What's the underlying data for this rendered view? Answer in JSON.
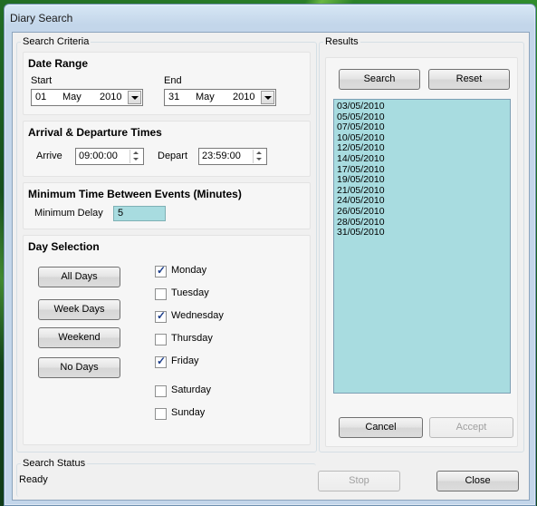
{
  "window": {
    "title": "Diary Search"
  },
  "search_criteria": {
    "legend": "Search Criteria",
    "date_range": {
      "heading": "Date Range",
      "start_label": "Start",
      "end_label": "End",
      "start": {
        "day": "01",
        "month": "May",
        "year": "2010"
      },
      "end": {
        "day": "31",
        "month": "May",
        "year": "2010"
      }
    },
    "times": {
      "heading": "Arrival & Departure Times",
      "arrive_label": "Arrive",
      "arrive_value": "09:00:00",
      "depart_label": "Depart",
      "depart_value": "23:59:00"
    },
    "min_time": {
      "heading": "Minimum Time Between Events (Minutes)",
      "label": "Minimum Delay",
      "value": "5"
    },
    "day_selection": {
      "heading": "Day Selection",
      "buttons": [
        "All Days",
        "Week Days",
        "Weekend",
        "No Days"
      ],
      "days": [
        {
          "label": "Monday",
          "checked": true
        },
        {
          "label": "Tuesday",
          "checked": false
        },
        {
          "label": "Wednesday",
          "checked": true
        },
        {
          "label": "Thursday",
          "checked": false
        },
        {
          "label": "Friday",
          "checked": true
        },
        {
          "label": "Saturday",
          "checked": false
        },
        {
          "label": "Sunday",
          "checked": false
        }
      ]
    }
  },
  "results": {
    "legend": "Results",
    "search_label": "Search",
    "reset_label": "Reset",
    "items": [
      "03/05/2010",
      "05/05/2010",
      "07/05/2010",
      "10/05/2010",
      "12/05/2010",
      "14/05/2010",
      "17/05/2010",
      "19/05/2010",
      "21/05/2010",
      "24/05/2010",
      "26/05/2010",
      "28/05/2010",
      "31/05/2010"
    ],
    "cancel_label": "Cancel",
    "accept_label": "Accept"
  },
  "status": {
    "legend": "Search Status",
    "text": "Ready",
    "stop_label": "Stop",
    "close_label": "Close"
  },
  "colors": {
    "list_bg": "#a8dce0",
    "window_frame": "#c3d6ea"
  }
}
